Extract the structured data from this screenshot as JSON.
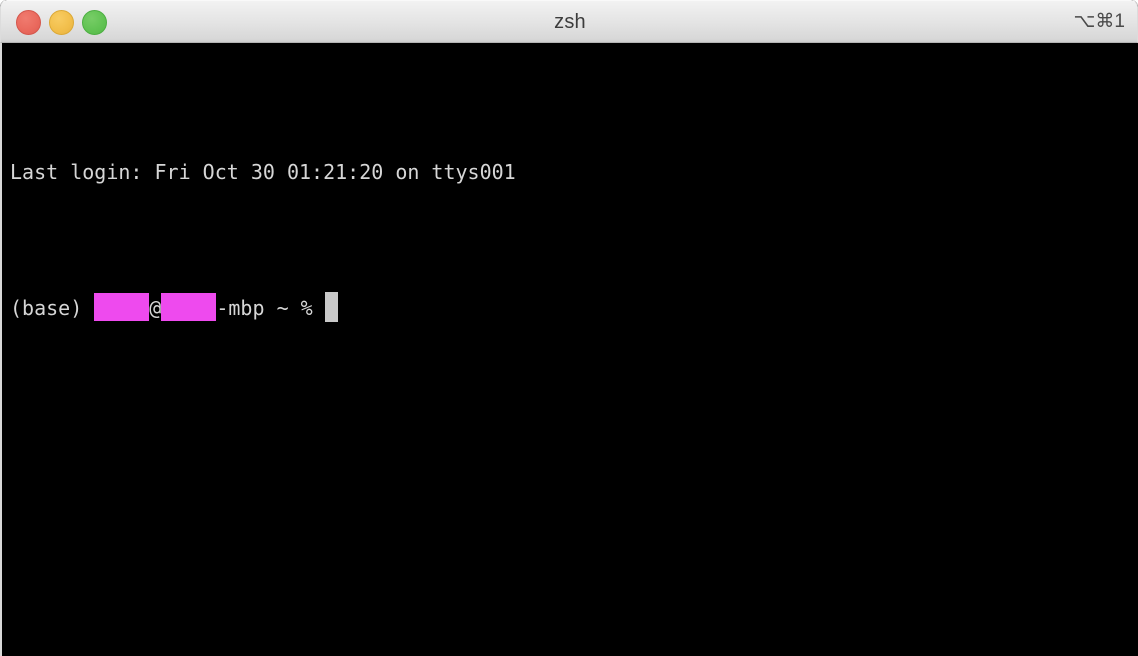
{
  "window": {
    "title": "zsh",
    "shortcut_badge": "⌥⌘1",
    "traffic_lights": {
      "close_label": "close",
      "minimize_label": "minimize",
      "zoom_label": "zoom"
    },
    "colors": {
      "close": "#ea6a5e",
      "minimize": "#f2bf4c",
      "zoom": "#62c354",
      "titlebar_top": "#f2f2f2",
      "titlebar_bottom": "#cfcfcf",
      "title_text": "#3c3c3c",
      "terminal_background": "#000000",
      "terminal_text": "#d6d6d6",
      "redaction": "#ee4aee",
      "cursor": "#c9c9c9"
    }
  },
  "terminal": {
    "lines": [
      {
        "id": "last-login-line",
        "text": "Last login: Fri Oct 30 01:21:20 on ttys001"
      }
    ],
    "prompt": {
      "env_prefix": "(base) ",
      "username_redacted": "",
      "at_sign": "@",
      "hostname_redacted": "",
      "host_suffix": "-mbp ",
      "working_directory": "~ ",
      "symbol": "% ",
      "cursor": ""
    }
  }
}
